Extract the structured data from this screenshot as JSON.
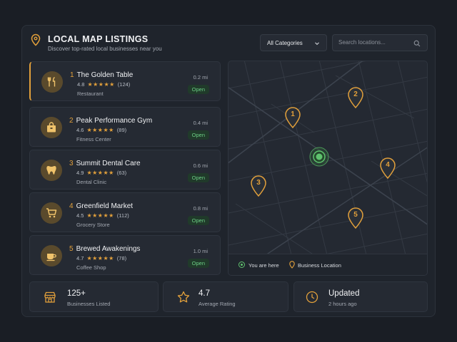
{
  "header": {
    "title": "LOCAL MAP LISTINGS",
    "subtitle": "Discover top-rated local businesses near you",
    "icon": "map-pin-icon"
  },
  "filters": {
    "category_selected": "All Categories",
    "search_placeholder": "Search locations..."
  },
  "listings": [
    {
      "number": "1",
      "name": "The Golden Table",
      "rating": "4.8",
      "stars": "★★★★★",
      "reviews": "(124)",
      "category": "Restaurant",
      "distance": "0.2 mi",
      "status": "Open",
      "icon": "utensils-icon"
    },
    {
      "number": "2",
      "name": "Peak Performance Gym",
      "rating": "4.6",
      "stars": "★★★★★",
      "reviews": "(89)",
      "category": "Fitness Center",
      "distance": "0.4 mi",
      "status": "Open",
      "icon": "bag-icon"
    },
    {
      "number": "3",
      "name": "Summit Dental Care",
      "rating": "4.9",
      "stars": "★★★★★",
      "reviews": "(63)",
      "category": "Dental Clinic",
      "distance": "0.6 mi",
      "status": "Open",
      "icon": "tooth-icon"
    },
    {
      "number": "4",
      "name": "Greenfield Market",
      "rating": "4.5",
      "stars": "★★★★★",
      "reviews": "(112)",
      "category": "Grocery Store",
      "distance": "0.8 mi",
      "status": "Open",
      "icon": "cart-icon"
    },
    {
      "number": "5",
      "name": "Brewed Awakenings",
      "rating": "4.7",
      "stars": "★★★★★",
      "reviews": "(78)",
      "category": "Coffee Shop",
      "distance": "1.0 mi",
      "status": "Open",
      "icon": "coffee-cup-icon"
    }
  ],
  "map": {
    "markers": [
      "1",
      "2",
      "3",
      "4",
      "5"
    ],
    "legend_you": "You are here",
    "legend_business": "Business Location"
  },
  "stats": [
    {
      "value": "125+",
      "label": "Businesses Listed",
      "icon": "store-icon"
    },
    {
      "value": "4.7",
      "label": "Average Rating",
      "icon": "star-icon"
    },
    {
      "value": "Updated",
      "label": "2 hours ago",
      "icon": "clock-icon"
    }
  ],
  "colors": {
    "accent": "#e2a03b",
    "open_green": "#6ccf85",
    "background": "#1a1e25",
    "panel": "#1f242c"
  }
}
